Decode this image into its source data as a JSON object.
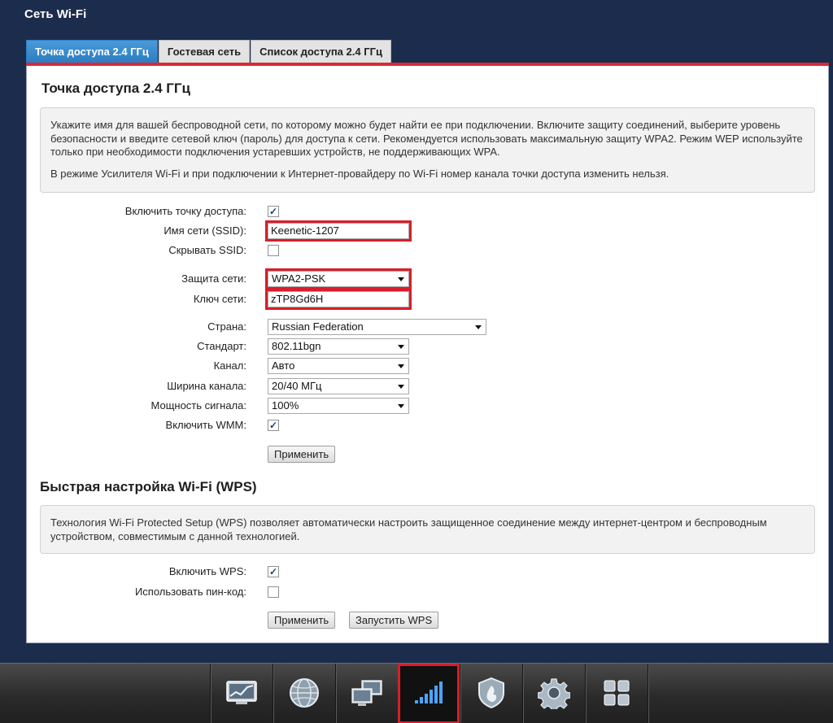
{
  "window": {
    "title": "Сеть Wi-Fi"
  },
  "tabs": [
    {
      "label": "Точка доступа 2.4 ГГц"
    },
    {
      "label": "Гостевая сеть"
    },
    {
      "label": "Список доступа 2.4 ГГц"
    }
  ],
  "ap": {
    "heading": "Точка доступа 2.4 ГГц",
    "info": [
      "Укажите имя для вашей беспроводной сети, по которому можно будет найти ее при подключении. Включите защиту соединений, выберите уровень безопасности и введите сетевой ключ (пароль) для доступа к сети. Рекомендуется использовать максимальную защиту WPA2. Режим WEP используйте только при необходимости подключения устаревших устройств, не поддерживающих WPA.",
      "В режиме Усилителя Wi-Fi и при подключении к Интернет-провайдеру по Wi-Fi номер канала точки доступа изменить нельзя."
    ],
    "enable_label": "Включить точку доступа:",
    "enable_checked": true,
    "ssid_label": "Имя сети (SSID):",
    "ssid_value": "Keenetic-1207",
    "hide_ssid_label": "Скрывать SSID:",
    "hide_ssid_checked": false,
    "security_label": "Защита сети:",
    "security_value": "WPA2-PSK",
    "key_label": "Ключ сети:",
    "key_value": "zTP8Gd6H",
    "country_label": "Страна:",
    "country_value": "Russian Federation",
    "standard_label": "Стандарт:",
    "standard_value": "802.11bgn",
    "channel_label": "Канал:",
    "channel_value": "Авто",
    "width_label": "Ширина канала:",
    "width_value": "20/40 МГц",
    "power_label": "Мощность сигнала:",
    "power_value": "100%",
    "wmm_label": "Включить WMM:",
    "wmm_checked": true,
    "apply_label": "Применить"
  },
  "wps": {
    "heading": "Быстрая настройка Wi-Fi (WPS)",
    "info": "Технология Wi-Fi Protected Setup (WPS) позволяет автоматически настроить защищенное соединение между интернет-центром и беспроводным устройством, совместимым с данной технологией.",
    "enable_label": "Включить WPS:",
    "enable_checked": true,
    "pin_label": "Использовать пин-код:",
    "pin_checked": false,
    "apply_label": "Применить",
    "start_label": "Запустить WPS"
  },
  "dock": {
    "items": [
      {
        "icon": "monitor-chart-icon"
      },
      {
        "icon": "globe-icon"
      },
      {
        "icon": "network-computers-icon"
      },
      {
        "icon": "wifi-signal-icon",
        "active": true
      },
      {
        "icon": "shield-icon"
      },
      {
        "icon": "gear-icon"
      },
      {
        "icon": "apps-grid-icon"
      }
    ]
  }
}
